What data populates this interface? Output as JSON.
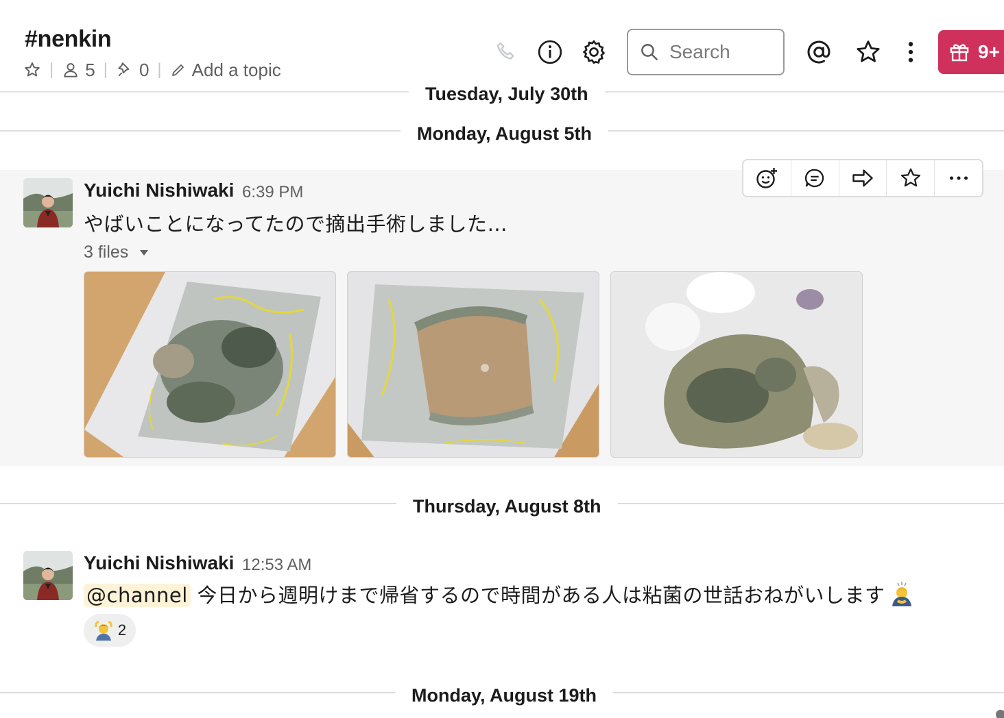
{
  "header": {
    "channel_name": "#nenkin",
    "members_count": "5",
    "pins_count": "0",
    "add_topic_label": "Add a topic",
    "search_placeholder": "Search",
    "gift_badge": "9+"
  },
  "dates": {
    "d1": "Tuesday, July 30th",
    "d2": "Monday, August 5th",
    "d3": "Thursday, August 8th",
    "d4": "Monday, August 19th"
  },
  "messages": [
    {
      "author": "Yuichi Nishiwaki",
      "time": "6:39 PM",
      "text": "やばいことになってたので摘出手術しました…",
      "files_label": "3 files"
    },
    {
      "author": "Yuichi Nishiwaki",
      "time": "12:53 AM",
      "mention": "@channel",
      "text": " 今日から週明けまで帰省するので時間がある人は粘菌の世話おねがいします",
      "reaction_count": "2"
    }
  ],
  "colors": {
    "accent_gift": "#d0305c",
    "mention_bg": "#fdf3d8"
  },
  "icons": [
    "star-icon",
    "person-icon",
    "pin-icon",
    "pencil-icon",
    "phone-icon",
    "info-icon",
    "gear-icon",
    "search-icon",
    "at-icon",
    "star-icon",
    "kebab-icon",
    "gift-icon",
    "add-reaction-icon",
    "thread-icon",
    "share-icon",
    "star-icon",
    "more-icon",
    "caret-down-icon"
  ]
}
